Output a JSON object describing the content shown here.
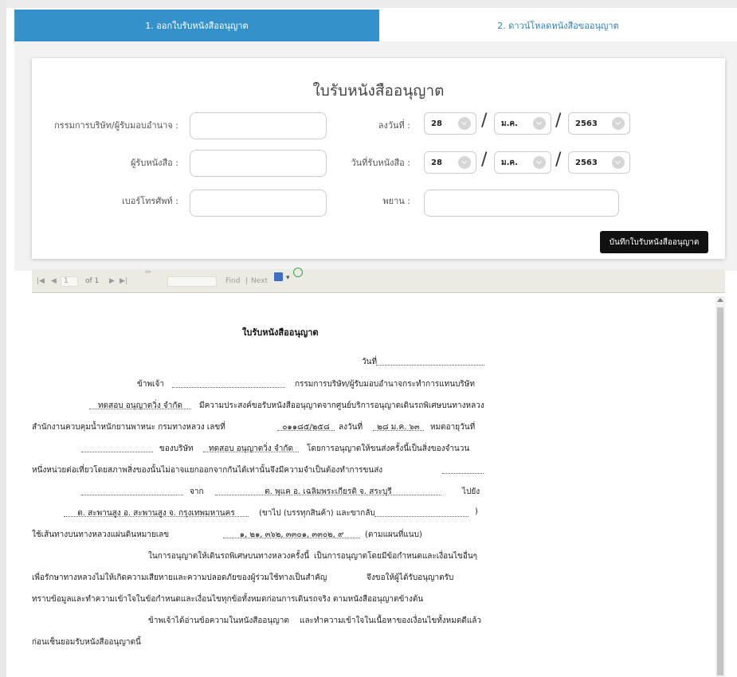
{
  "tabs": [
    {
      "label": "1. ออกใบรับหนังสืออนุญาต"
    },
    {
      "label": "2. ดาวน์โหลดหนังสือขออนุญาต"
    }
  ],
  "form": {
    "title": "ใบรับหนังสืออนุญาต",
    "director_label": "กรรมการบริษัท/ผู้รับมอบอำนาจ :",
    "director_value": "",
    "receiver_label": "ผู้รับหนังสือ :",
    "receiver_value": "",
    "phone_label": "เบอร์โทรศัพท์ :",
    "phone_value": "",
    "signed_date_label": "ลงวันที่ :",
    "received_date_label": "วันที่รับหนังสือ :",
    "witness_label": "พยาน :",
    "witness_value": "",
    "signed_date": {
      "day": "28",
      "month": "ม.ค.",
      "year": "2563"
    },
    "received_date": {
      "day": "28",
      "month": "ม.ค.",
      "year": "2563"
    },
    "date_separator": "/",
    "save_button": "บันทึกใบรับหนังสืออนุญาต"
  },
  "viewer": {
    "page_current": "1",
    "page_of": "of 1",
    "find_label": "Find",
    "separator": "|",
    "next_label": "Next",
    "icons": [
      "first-page-icon",
      "prev-page-icon",
      "next-page-icon",
      "last-page-icon",
      "back-icon",
      "save-icon",
      "export-dropdown-icon",
      "refresh-icon"
    ]
  },
  "report": {
    "title": "ใบรับหนังสืออนุญาต",
    "date_label": "วันที่",
    "l1_a": "ข้าพเจ้า",
    "l1_b": "กรรมการบริษัท/ผู้รับมอบอำนาจกระทำการแทนบริษัท",
    "company_name": "ทดสอบ อนุญาตวิ่ง จำกัด",
    "l2_b": "มีความประสงค์ขอรับหนังสืออนุญาตจากศูนย์บริการอนุญาตเดินรถพิเศษบนทางหลวง",
    "l3_a": "สำนักงานควบคุมน้ำหนักยานพาหนะ กรมทางหลวง เลขที่",
    "permit_no": "๐๑๑๘๕/๒๕๘",
    "l3_b": "ลงวันที่",
    "permit_date": "๒๘ ม.ค. ๖๓",
    "l3_c": "หมดอายุวันที่",
    "l4_a": "ของบริษัท",
    "company_name_2": "ทดสอบ อนุญาตวิ่ง จำกัด",
    "l4_b": "โดยการอนุญาตให้ขนส่งครั้งนี้เป็นสิ่งของจำนวน",
    "l5": "หนึ่งหน่วยต่อเที่ยวโดยสภาพสิ่งของนั้นไม่อาจแยกออกจากกันได้เท่านั้นจึงมีความจำเป็นต้องทำการขนส่ง",
    "l6_from": "จาก",
    "from_place": "ต. พุแค อ. เฉลิมพระเกียรติ จ. สระบุรี",
    "l6_to": "ไปยัง",
    "to_place": "ต. สะพานสูง อ. สะพานสูง จ. กรุงเทพมหานคร",
    "l7_a": "(ขาไป (บรรทุกสินค้า) และขากลับ",
    "l7_close": ")",
    "l8_a": "ใช้เส้นทางบนทางหลวงแผ่นดินหมายเลข",
    "routes": "๑, ๒๑, ๓๖๒, ๓๓๐๑, ๓๓๐๒, ๙",
    "l8_b": "(ตามแผนที่แนบ)",
    "l9_a": "ในการอนุญาตให้เดินรถพิเศษบนทางหลวงครั้งนี้",
    "l9_b": "เป็นการอนุญาตโดยมีข้อกำหนดและเงื่อนไขอื่นๆ",
    "l10_a": "เพื่อรักษาทางหลวงไม่ให้เกิดความเสียหายและความปลอดภัยของผู้ร่วมใช้ทางเป็นสำคัญ",
    "l10_b": "จึงขอให้ผู้ได้รับอนุญาตรับ",
    "l11": "ทราบข้อมูลและทำความเข้าใจในข้อกำหนดและเงื่อนไขทุกข้อทั้งหมดก่อนการเดินรถจริง ตามหนังสืออนุญาตข้างต้น",
    "l12_a": "ข้าพเจ้าได้อ่านข้อความในหนังสืออนุญาต",
    "l12_b": "และทำความเข้าใจในเนื้อหาของเงื่อนไขทั้งหมดดีแล้ว",
    "l13": "ก่อนเซ็นยอมรับหนังสืออนุญาตนี้"
  },
  "colors": {
    "tab_active": "#3591c9",
    "tab_inactive_text": "#2f7fb8",
    "button": "#111111"
  }
}
